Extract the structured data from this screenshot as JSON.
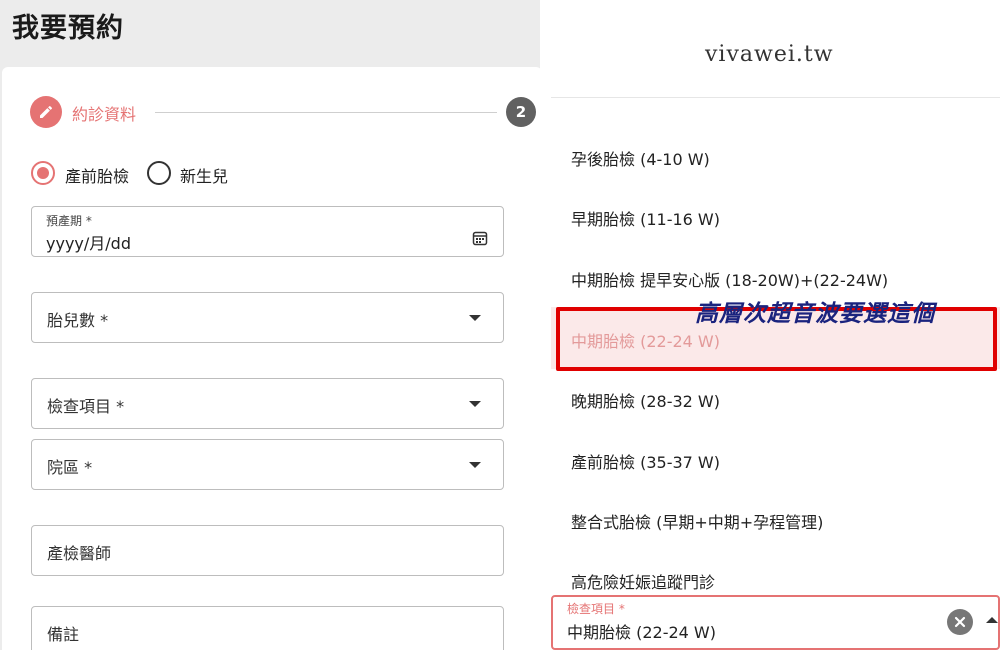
{
  "page": {
    "title": "我要預約"
  },
  "stepper": {
    "step1_label": "約診資料",
    "step2_number": "2"
  },
  "visit_type": {
    "options": [
      "產前胎檢",
      "新生兒"
    ],
    "selected": "產前胎檢"
  },
  "form": {
    "due_date": {
      "label": "預產期 *",
      "value": "yyyy/月/dd"
    },
    "fetus_count": {
      "label": "胎兒數 *"
    },
    "exam_item": {
      "label": "檢查項目 *"
    },
    "branch": {
      "label": "院區 *"
    },
    "doctor": {
      "label": "產檢醫師"
    },
    "notes": {
      "label": "備註"
    }
  },
  "watermark": "vivawei.tw",
  "dropdown": {
    "options": [
      "孕後胎檢 (4-10 W)",
      "早期胎檢 (11-16 W)",
      "中期胎檢 提早安心版 (18-20W)+(22-24W)",
      "中期胎檢 (22-24 W)",
      "晚期胎檢 (28-32 W)",
      "產前胎檢 (35-37 W)",
      "整合式胎檢 (早期+中期+孕程管理)",
      "高危險妊娠追蹤門診"
    ],
    "selected_index": 3,
    "annotation": "高層次超音波要選這個",
    "field_label": "檢查項目 *",
    "field_value": "中期胎檢 (22-24 W)"
  },
  "colors": {
    "accent": "#e57373",
    "highlight_border": "#e00000",
    "annotation_text": "#1a237e"
  }
}
